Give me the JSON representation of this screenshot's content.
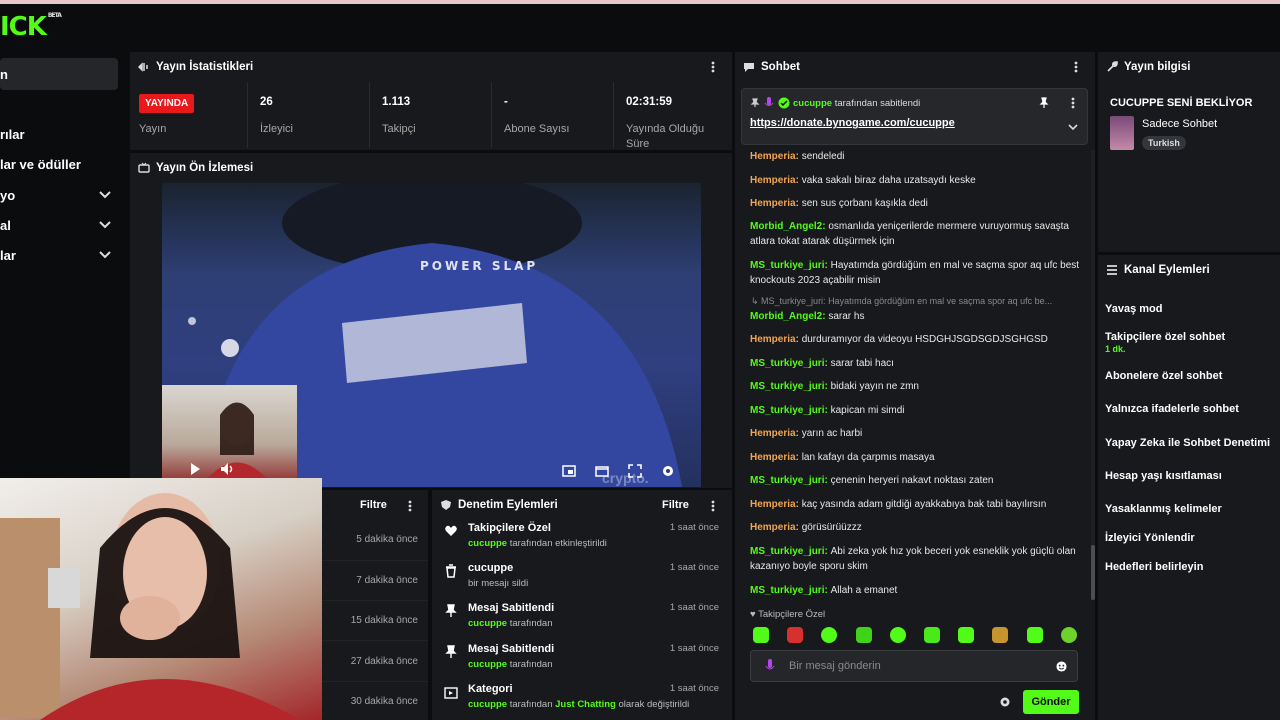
{
  "brand": {
    "logo_text": "ICK",
    "beta_label": "BETA"
  },
  "sidebar": {
    "items": [
      {
        "label": "n"
      },
      {
        "label": "rılar"
      },
      {
        "label": "lar ve ödüller"
      },
      {
        "label": "yo"
      },
      {
        "label": "al"
      },
      {
        "label": "lar"
      }
    ]
  },
  "stats": {
    "title": "Yayın İstatistikleri",
    "live_badge": "YAYINDA",
    "items": [
      {
        "value": "",
        "label": "Yayın"
      },
      {
        "value": "26",
        "label": "İzleyici"
      },
      {
        "value": "1.113",
        "label": "Takipçi"
      },
      {
        "value": "-",
        "label": "Abone Sayısı"
      },
      {
        "value": "02:31:59",
        "label": "Yayında Olduğu Süre"
      }
    ]
  },
  "preview": {
    "title": "Yayın Ön İzlemesi",
    "jersey_text": "POWER SLAP",
    "watermark": "crypto."
  },
  "logs": {
    "filter_label": "Filtre",
    "times": [
      "5 dakika önce",
      "7 dakika önce",
      "15 dakika önce",
      "27 dakika önce",
      "30 dakika önce"
    ]
  },
  "moderation": {
    "title": "Denetim Eylemleri",
    "filter_label": "Filtre",
    "items": [
      {
        "title": "Takipçilere Özel",
        "user": "cucuppe",
        "desc": "tarafından etkinleştirildi",
        "time": "1 saat önce"
      },
      {
        "title": "cucuppe",
        "user": "",
        "desc": "bir mesajı sildi",
        "time": "1 saat önce"
      },
      {
        "title": "Mesaj Sabitlendi",
        "user": "cucuppe",
        "desc": "tarafından",
        "time": "1 saat önce"
      },
      {
        "title": "Mesaj Sabitlendi",
        "user": "cucuppe",
        "desc": "tarafından",
        "time": "1 saat önce"
      },
      {
        "title": "Kategori",
        "user": "cucuppe",
        "desc": "tarafından",
        "category": "Just Chatting",
        "desc2": "olarak değiştirildi",
        "time": "1 saat önce"
      }
    ]
  },
  "chat": {
    "title": "Sohbet",
    "pinned": {
      "user": "cucuppe",
      "suffix": "tarafından sabitlendi",
      "link": "https://donate.bynogame.com/cucuppe"
    },
    "messages": [
      {
        "user": "Hemperia",
        "text": "sendeledi",
        "color": "h"
      },
      {
        "user": "Hemperia",
        "text": "vaka sakalı biraz daha uzatsaydı keske",
        "color": "h"
      },
      {
        "user": "Hemperia",
        "text": "sen sus çorbanı kaşıkla dedi",
        "color": "h"
      },
      {
        "user": "Morbid_Angel2",
        "text": "osmanlıda yeniçerilerde mermere vuruyormuş savaşta atlara tokat atarak düşürmek için",
        "color": "g"
      },
      {
        "user": "MS_turkiye_juri",
        "text": "Hayatımda gördüğüm en mal ve saçma spor aq ufc best knockouts 2023 açabilir misin",
        "color": "g"
      },
      {
        "user": "Morbid_Angel2",
        "text": "sarar hs",
        "color": "g"
      },
      {
        "user": "Hemperia",
        "text": "durduramıyor da videoyu HSDGHJSGDSGDJSGHGSD",
        "color": "h"
      },
      {
        "user": "MS_turkiye_juri",
        "text": "sarar tabi hacı",
        "color": "g"
      },
      {
        "user": "MS_turkiye_juri",
        "text": "bidaki yayın ne zmn",
        "color": "g"
      },
      {
        "user": "MS_turkiye_juri",
        "text": "kapican mi simdi",
        "color": "g"
      },
      {
        "user": "Hemperia",
        "text": "yarın ac harbi",
        "color": "h"
      },
      {
        "user": "Hemperia",
        "text": "lan kafayı da çarpmıs masaya",
        "color": "h"
      },
      {
        "user": "MS_turkiye_juri",
        "text": "çenenin heryeri nakavt noktası zaten",
        "color": "g"
      },
      {
        "user": "Hemperia",
        "text": "kaç yasında adam gitdiği ayakkabıya bak tabi bayılırsın",
        "color": "h"
      },
      {
        "user": "Hemperia",
        "text": "görüsürüüzzz",
        "color": "h"
      },
      {
        "user": "MS_turkiye_juri",
        "text": "Abi zeka yok hız yok beceri yok esneklik yok güçlü olan kazanıyo boyle sporu skim",
        "color": "g"
      },
      {
        "user": "MS_turkiye_juri",
        "text": "Allah a emanet",
        "color": "g"
      }
    ],
    "reply_hint": "↳ MS_turkiye_juri: Hayatımda gördüğüm en mal ve saçma spor aq ufc be...",
    "mode_label": "Takipçilere Özel",
    "input_placeholder": "Bir mesaj gönderin",
    "send_label": "Gönder"
  },
  "stream_info": {
    "title": "Yayın bilgisi",
    "stream_title": "CUCUPPE SENİ BEKLİYOR",
    "category": "Sadece Sohbet",
    "tag": "Turkish"
  },
  "channel_actions": {
    "title": "Kanal Eylemleri",
    "items": [
      {
        "label": "Yavaş mod"
      },
      {
        "label": "Takipçilere özel sohbet",
        "sub": "1 dk."
      },
      {
        "label": "Abonelere özel sohbet"
      },
      {
        "label": "Yalnızca ifadelerle sohbet"
      },
      {
        "label": "Yapay Zeka ile Sohbet Denetimi"
      },
      {
        "label": "Hesap yaşı kısıtlaması"
      },
      {
        "label": "Yasaklanmış kelimeler"
      },
      {
        "label": "İzleyici Yönlendir"
      },
      {
        "label": "Hedefleri belirleyin"
      }
    ]
  },
  "colors": {
    "accent": "#53fc18",
    "live": "#e8181b",
    "user_alt": "#f0a553",
    "panel": "#18191c"
  }
}
